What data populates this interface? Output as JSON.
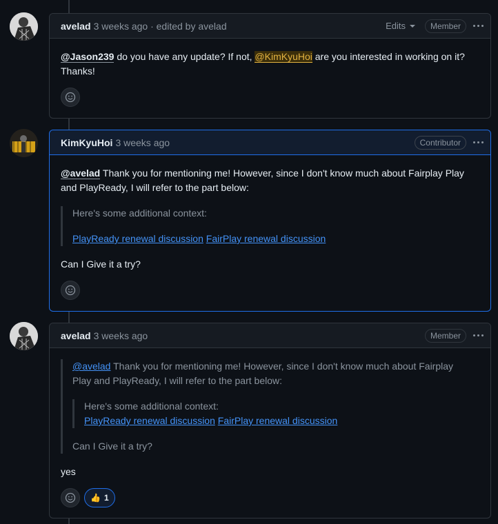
{
  "comments": [
    {
      "author": "avelad",
      "meta": "3 weeks ago · edited by avelad",
      "edits_label": "Edits",
      "badge": "Member",
      "body": {
        "mention1": "@Jason239",
        "text1": " do you have any update? If not, ",
        "mention2": "@KimKyuHoi",
        "text2": " are you interested in working on it?",
        "text3": "Thanks!"
      }
    },
    {
      "author": "KimKyuHoi",
      "meta": "3 weeks ago",
      "badge": "Contributor",
      "body": {
        "mention": "@avelad",
        "line1": " Thank you for mentioning me! However, since I don't know much about Fairplay Play",
        "line2": "and PlayReady, I will refer to the part below:",
        "quote": "Here's some additional context:",
        "link1": "PlayReady renewal discussion",
        "link2": "FairPlay renewal discussion",
        "closing": "Can I Give it a try?"
      }
    },
    {
      "author": "avelad",
      "meta": "3 weeks ago",
      "badge": "Member",
      "body": {
        "quote_mention": "@avelad",
        "quote_line1": " Thank you for mentioning me! However, since I don't know much about Fairplay",
        "quote_line2": "Play and PlayReady, I will refer to the part below:",
        "nested_quote": "Here's some additional context:",
        "link1": "PlayReady renewal discussion",
        "link2": "FairPlay renewal discussion",
        "quote_closing": "Can I Give it a try?",
        "reply": "yes"
      },
      "reactions": [
        {
          "icon": "thumbs-up-icon",
          "emoji": "👍",
          "count": "1"
        }
      ]
    }
  ]
}
